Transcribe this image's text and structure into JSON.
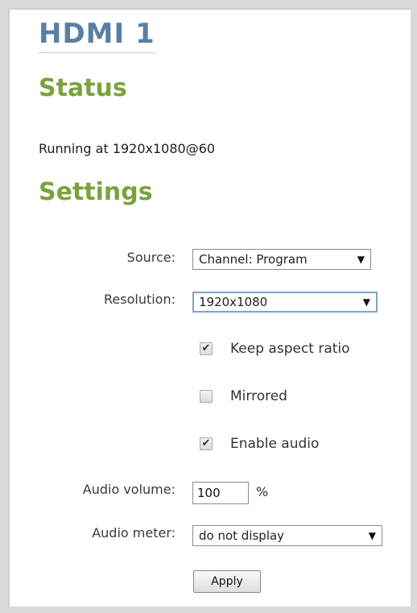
{
  "page": {
    "title": "HDMI 1",
    "status_heading": "Status",
    "status_text": "Running at 1920x1080@60",
    "settings_heading": "Settings"
  },
  "settings": {
    "source": {
      "label": "Source:",
      "value": "Channel: Program"
    },
    "resolution": {
      "label": "Resolution:",
      "value": "1920x1080"
    },
    "keep_aspect": {
      "label": "Keep aspect ratio",
      "checked": true
    },
    "mirrored": {
      "label": "Mirrored",
      "checked": false
    },
    "enable_audio": {
      "label": "Enable audio",
      "checked": true
    },
    "audio_volume": {
      "label": "Audio volume:",
      "value": "100",
      "unit": "%"
    },
    "audio_meter": {
      "label": "Audio meter:",
      "value": "do not display"
    },
    "apply_label": "Apply"
  },
  "icons": {
    "dropdown": "▼",
    "check": "✔"
  },
  "colors": {
    "title": "#5a7fa3",
    "heading": "#7aa33d",
    "focus_border": "#7fa3d0"
  }
}
